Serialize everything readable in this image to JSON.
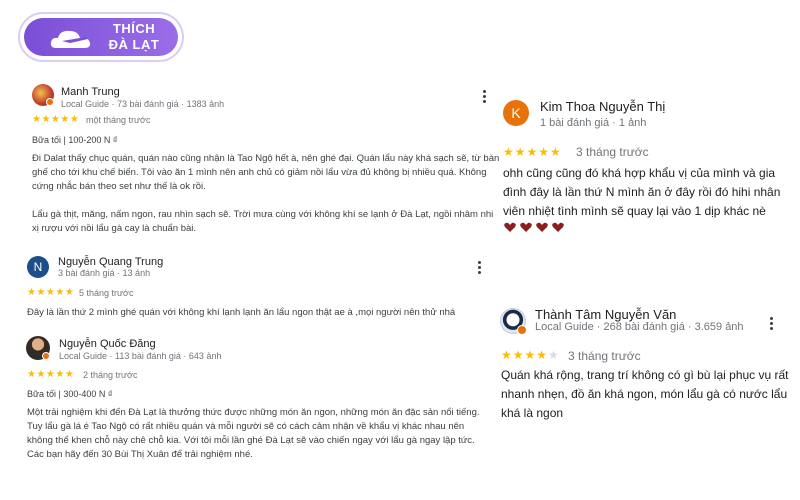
{
  "logo": {
    "line1": "THÍCH",
    "line2": "ĐÀ LẠT"
  },
  "reviews_left": [
    {
      "name": "Manh Trung",
      "meta": "Local Guide · 73 bài đánh giá · 1383 ảnh",
      "stars": "★★★★★",
      "time": "một tháng trước",
      "price": "Bữa tối  |  100-200 N ₫",
      "body": "Đi Dalat thấy chục quán, quán nào cũng nhận là Tao Ngộ hết à, nên ghé đại. Quán lẩu này khá sạch sẽ, từ bàn ghế cho tới khu chế biến. Tôi vào ăn 1 mình nên anh chủ có giảm nồi lẩu vừa đủ không bị nhiều quá. Không cứng nhắc bán theo set như thế là ok rồi.",
      "body2": "Lẩu gà thịt, măng, nấm ngon, rau nhìn sạch sẽ. Trời mưa cùng với không khí se lạnh ở Đà Lạt, ngồi nhâm nhi xị rượu với nồi lẩu gà cay là chuẩn bài."
    },
    {
      "name": "Nguyễn Quang Trung",
      "initial": "N",
      "meta": "3 bài đánh giá · 13 ảnh",
      "stars": "★★★★★",
      "time": "5 tháng trước",
      "body": "Đây là lần thứ 2 mình ghé quán với không khí lạnh lạnh ăn lẩu ngon thật ae à ,mọi người nên thử nhá"
    },
    {
      "name": "Nguyễn Quốc Đăng",
      "meta": "Local Guide · 113 bài đánh giá · 643 ảnh",
      "stars": "★★★★★",
      "time": "2 tháng trước",
      "price": "Bữa tối  |  300-400 N ₫",
      "body": "Một trải nghiệm khi đến Đà Lạt là thưởng thức được những món ăn ngon, những món ăn đặc sản nổi tiếng. Tuy lẩu gà lá é Tao Ngộ có rất nhiều quán và mỗi người sẽ có cách cảm nhận về khẩu vị khác nhau nên không thể khen chỗ này chê chỗ kia. Với tôi mỗi lần ghé Đà Lạt sẽ vào chiến ngay với lẩu gà ngay lập tức. Các bạn hãy đến 30 Bùi Thị Xuân để trải nghiệm nhé."
    }
  ],
  "reviews_right": [
    {
      "name": "Kim Thoa Nguyễn Thị",
      "initial": "K",
      "meta": "1 bài đánh giá · 1 ảnh",
      "stars": "★★★★★",
      "time": "3 tháng trước",
      "body": "ohh cũng cũng đó khá hợp khẩu vị của mình và gia đình đây là lần thứ N mình ăn ở đây rồi đó hihi nhân viên nhiệt tình mình sẽ quay lại vào 1 dịp khác nè"
    },
    {
      "name": "Thành Tâm Nguyễn Văn",
      "meta": "Local Guide · 268 bài đánh giá · 3.659 ảnh",
      "stars": "★★★★",
      "stars_empty": "★",
      "time": "3 tháng trước",
      "body": "Quán khá rộng, trang trí không có gì bù lại phục vụ rất nhanh nhẹn, đồ ăn khá ngon, món lẩu gà có nước lẩu khá là ngon"
    }
  ],
  "colors": {
    "star": "#fbbc04",
    "logo": "#8a5fe0",
    "avatar_n": "#1a4f8b",
    "avatar_k": "#e8710a"
  }
}
